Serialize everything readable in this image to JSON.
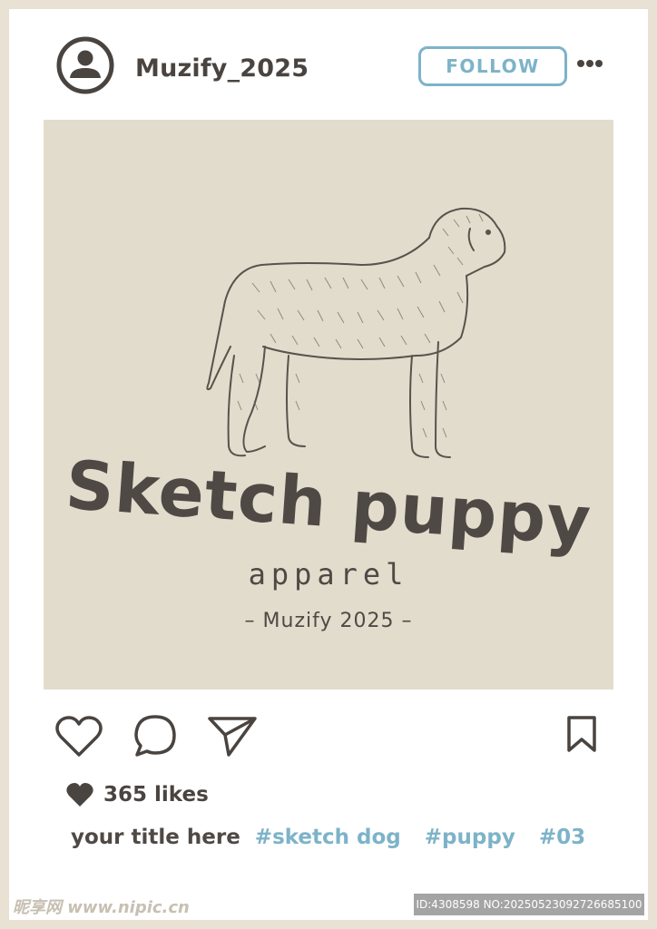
{
  "post": {
    "username": "Muzify_2025",
    "follow_label": "FOLLOW",
    "image": {
      "brand_title": "Sketch puppy",
      "brand_subtitle": "apparel",
      "brand_credit": "– Muzify 2025 –"
    },
    "likes": "365 likes",
    "caption": {
      "title": "your title here",
      "hashtags": [
        "#sketch dog",
        "#puppy",
        "#03"
      ]
    }
  },
  "icons": {
    "avatar": "user-avatar-icon",
    "more": "more-horizontal-icon",
    "like": "heart-outline-icon",
    "comment": "comment-bubble-icon",
    "share": "paper-plane-icon",
    "save": "bookmark-icon",
    "likes_heart": "heart-filled-icon"
  },
  "colors": {
    "accent": "#7db3c8",
    "text_dark": "#4a4440",
    "image_bg": "#e2dccc",
    "frame": "#e8e1d4"
  },
  "watermark": {
    "left": "昵享网 www.nipic.cn",
    "right": "ID:4308598 NO:20250523092726685100"
  }
}
